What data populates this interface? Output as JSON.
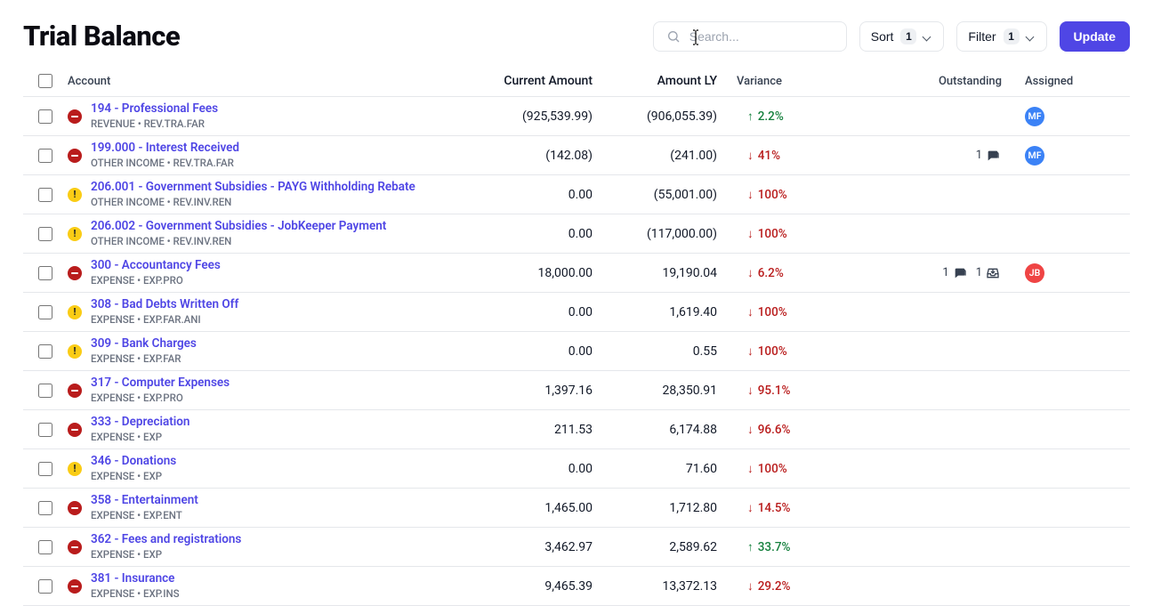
{
  "header": {
    "title": "Trial Balance",
    "search_placeholder": "Search...",
    "sort_label": "Sort",
    "sort_count": "1",
    "filter_label": "Filter",
    "filter_count": "1",
    "update_label": "Update"
  },
  "columns": {
    "account": "Account",
    "current": "Current Amount",
    "ly": "Amount LY",
    "variance": "Variance",
    "outstanding": "Outstanding",
    "assigned": "Assigned"
  },
  "rows": [
    {
      "status": "red",
      "name": "194 - Professional Fees",
      "sub": "REVENUE   •   REV.TRA.FAR",
      "current": "(925,539.99)",
      "ly": "(906,055.39)",
      "var_dir": "up",
      "var": "2.2%",
      "outstanding_comments": "",
      "outstanding_tray": "",
      "avatar": "MF",
      "avatar_color": "blue"
    },
    {
      "status": "red",
      "name": "199.000 - Interest Received",
      "sub": "OTHER INCOME   •   REV.TRA.FAR",
      "current": "(142.08)",
      "ly": "(241.00)",
      "var_dir": "down",
      "var": "41%",
      "outstanding_comments": "1",
      "outstanding_tray": "",
      "avatar": "MF",
      "avatar_color": "blue"
    },
    {
      "status": "yellow",
      "name": "206.001 - Government Subsidies - PAYG Withholding Rebate",
      "sub": "OTHER INCOME   •   REV.INV.REN",
      "current": "0.00",
      "ly": "(55,001.00)",
      "var_dir": "down",
      "var": "100%",
      "outstanding_comments": "",
      "outstanding_tray": "",
      "avatar": "",
      "avatar_color": ""
    },
    {
      "status": "yellow",
      "name": "206.002 - Government Subsidies - JobKeeper Payment",
      "sub": "OTHER INCOME   •   REV.INV.REN",
      "current": "0.00",
      "ly": "(117,000.00)",
      "var_dir": "down",
      "var": "100%",
      "outstanding_comments": "",
      "outstanding_tray": "",
      "avatar": "",
      "avatar_color": ""
    },
    {
      "status": "red",
      "name": "300 - Accountancy Fees",
      "sub": "EXPENSE   •   EXP.PRO",
      "current": "18,000.00",
      "ly": "19,190.04",
      "var_dir": "down",
      "var": "6.2%",
      "outstanding_comments": "1",
      "outstanding_tray": "1",
      "avatar": "JB",
      "avatar_color": "red"
    },
    {
      "status": "yellow",
      "name": "308 - Bad Debts Written Off",
      "sub": "EXPENSE   •   EXP.FAR.ANI",
      "current": "0.00",
      "ly": "1,619.40",
      "var_dir": "down",
      "var": "100%",
      "outstanding_comments": "",
      "outstanding_tray": "",
      "avatar": "",
      "avatar_color": ""
    },
    {
      "status": "yellow",
      "name": "309 - Bank Charges",
      "sub": "EXPENSE   •   EXP.FAR",
      "current": "0.00",
      "ly": "0.55",
      "var_dir": "down",
      "var": "100%",
      "outstanding_comments": "",
      "outstanding_tray": "",
      "avatar": "",
      "avatar_color": ""
    },
    {
      "status": "red",
      "name": "317 - Computer Expenses",
      "sub": "EXPENSE   •   EXP.PRO",
      "current": "1,397.16",
      "ly": "28,350.91",
      "var_dir": "down",
      "var": "95.1%",
      "outstanding_comments": "",
      "outstanding_tray": "",
      "avatar": "",
      "avatar_color": ""
    },
    {
      "status": "red",
      "name": "333 - Depreciation",
      "sub": "EXPENSE   •   EXP",
      "current": "211.53",
      "ly": "6,174.88",
      "var_dir": "down",
      "var": "96.6%",
      "outstanding_comments": "",
      "outstanding_tray": "",
      "avatar": "",
      "avatar_color": ""
    },
    {
      "status": "yellow",
      "name": "346 - Donations",
      "sub": "EXPENSE   •   EXP",
      "current": "0.00",
      "ly": "71.60",
      "var_dir": "down",
      "var": "100%",
      "outstanding_comments": "",
      "outstanding_tray": "",
      "avatar": "",
      "avatar_color": ""
    },
    {
      "status": "red",
      "name": "358 - Entertainment",
      "sub": "EXPENSE   •   EXP.ENT",
      "current": "1,465.00",
      "ly": "1,712.80",
      "var_dir": "down",
      "var": "14.5%",
      "outstanding_comments": "",
      "outstanding_tray": "",
      "avatar": "",
      "avatar_color": ""
    },
    {
      "status": "red",
      "name": "362 - Fees and registrations",
      "sub": "EXPENSE   •   EXP",
      "current": "3,462.97",
      "ly": "2,589.62",
      "var_dir": "up",
      "var": "33.7%",
      "outstanding_comments": "",
      "outstanding_tray": "",
      "avatar": "",
      "avatar_color": ""
    },
    {
      "status": "red",
      "name": "381 - Insurance",
      "sub": "EXPENSE   •   EXP.INS",
      "current": "9,465.39",
      "ly": "13,372.13",
      "var_dir": "down",
      "var": "29.2%",
      "outstanding_comments": "",
      "outstanding_tray": "",
      "avatar": "",
      "avatar_color": ""
    }
  ]
}
